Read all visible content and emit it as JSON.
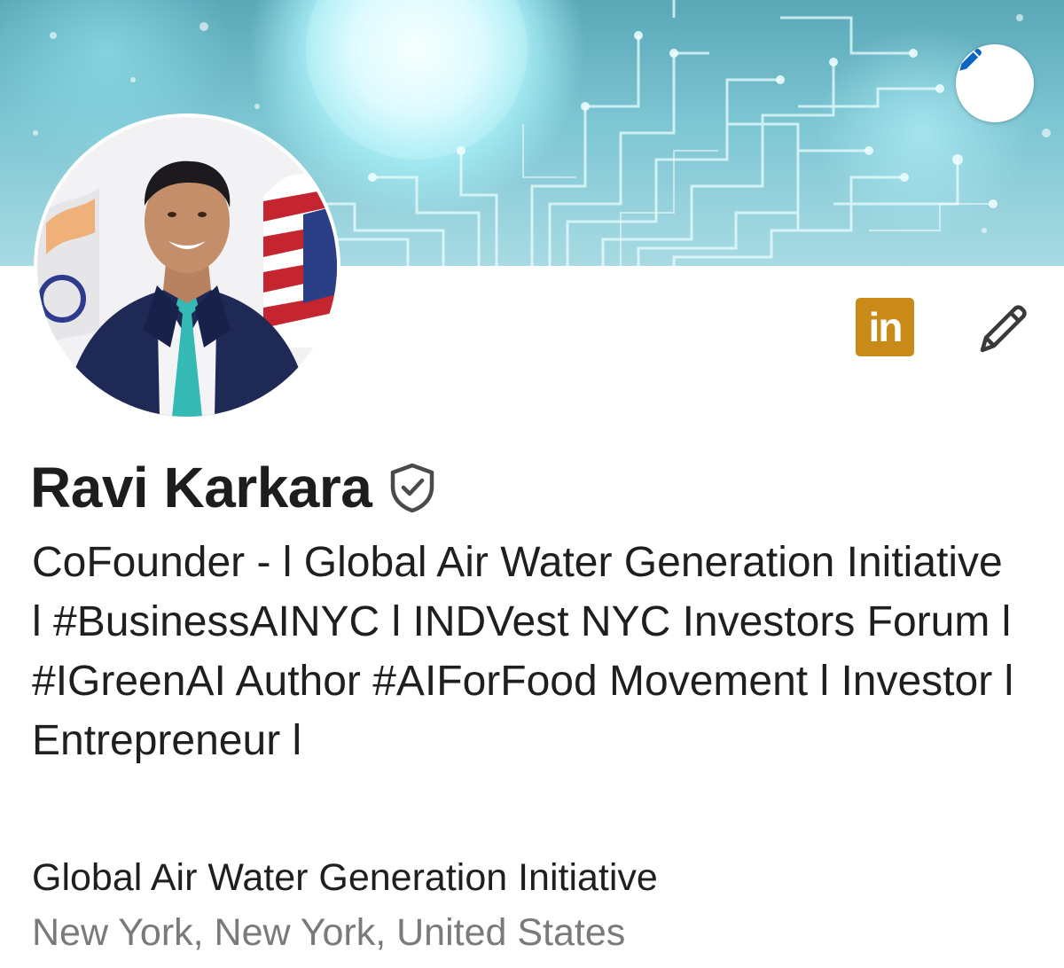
{
  "profile": {
    "name": "Ravi Karkara",
    "headline": "CoFounder - l Global Air Water Generation Initiative l #BusinessAINYC l INDVest NYC Investors Forum l #IGreenAI Author #AIForFood Movement l Investor l Entrepreneur l",
    "company": "Global Air Water Generation Initiative",
    "location": "New York, New York, United States"
  },
  "actions": {
    "linkedin_badge_text": "in"
  },
  "icons": {
    "banner_edit": "pencil-icon",
    "linkedin": "linkedin-icon",
    "profile_edit": "pencil-icon",
    "verified": "verified-shield-icon"
  },
  "colors": {
    "accent_blue": "#0a66c2",
    "linkedin_badge": "#c98a18",
    "name_text": "#1d1d1d",
    "location_text": "#7a7a7a"
  }
}
